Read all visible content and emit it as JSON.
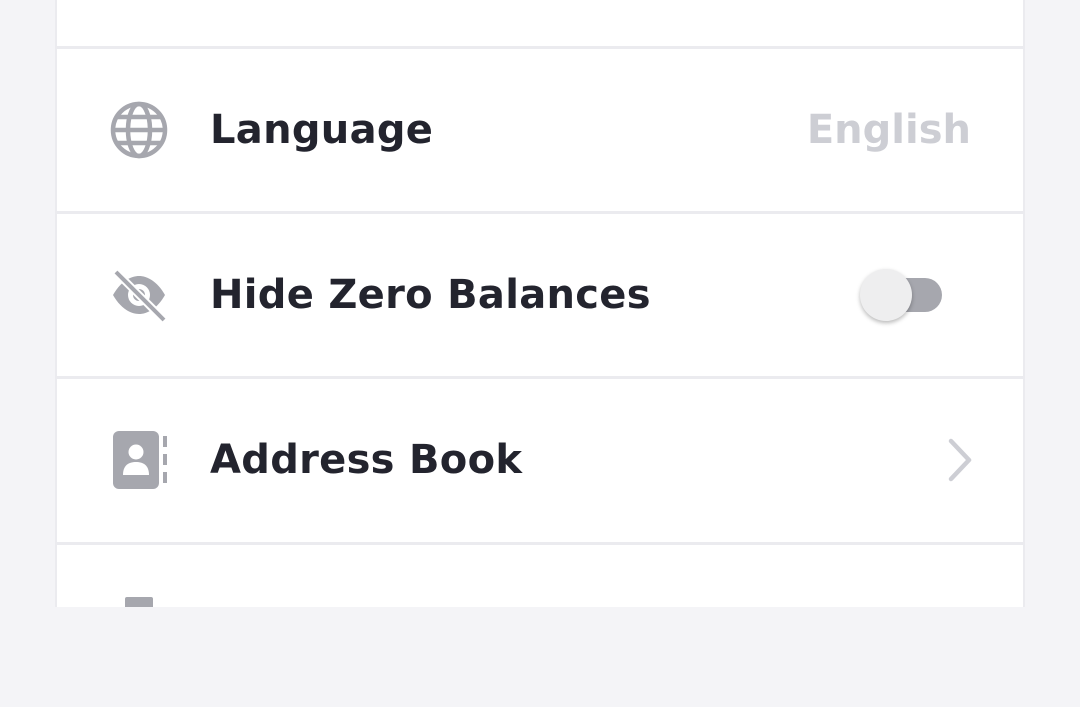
{
  "settings": {
    "items": [
      {
        "label": "Language",
        "value": "English",
        "icon": "globe-icon",
        "control": "value"
      },
      {
        "label": "Hide Zero Balances",
        "icon": "eye-slash-icon",
        "control": "toggle",
        "toggle_on": false
      },
      {
        "label": "Address Book",
        "icon": "address-book-icon",
        "control": "chevron"
      }
    ]
  },
  "colors": {
    "label": "#23242e",
    "value": "#cdced4",
    "icon": "#a6a7ae",
    "divider": "#ebebef",
    "background": "#f4f4f7"
  }
}
